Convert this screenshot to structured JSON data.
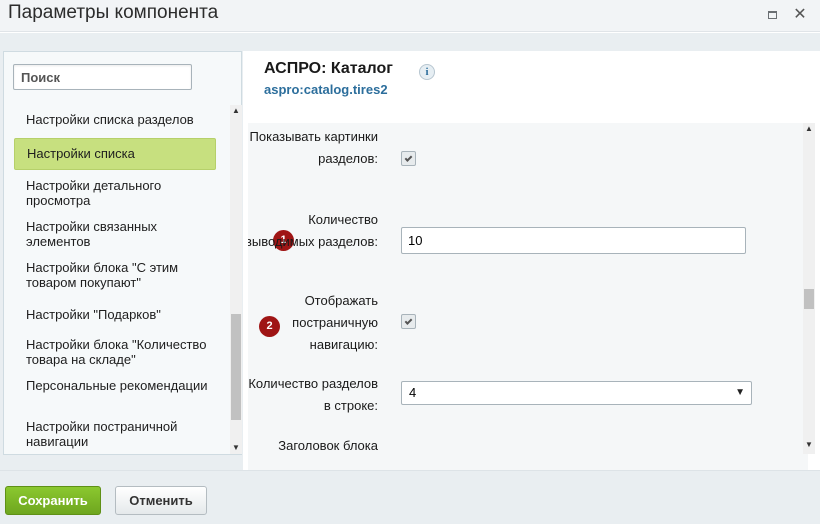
{
  "dialog": {
    "title": "Параметры компонента",
    "maximize_icon": "maximize-icon",
    "close_icon": "close-icon",
    "close_glyph": "✕"
  },
  "sidebar": {
    "search_placeholder": "Поиск",
    "items": [
      {
        "label": "Настройки списка разделов",
        "active": false
      },
      {
        "label": "Настройки списка",
        "active": true
      },
      {
        "label": "Настройки детального просмотра",
        "active": false
      },
      {
        "label": "Настройки связанных элементов",
        "active": false
      },
      {
        "label": "Настройки блока \"С этим товаром покупают\"",
        "active": false
      },
      {
        "label": "Настройки \"Подарков\"",
        "active": false
      },
      {
        "label": "Настройки блока \"Количество товара на складе\"",
        "active": false
      },
      {
        "label": "Персональные рекомендации",
        "active": false
      },
      {
        "label": "Настройки постраничной навигации",
        "active": false
      }
    ],
    "active_color": "#c7e07f"
  },
  "component": {
    "title": "АСПРО: Каталог",
    "info_icon": "info-icon",
    "info_glyph": "i",
    "code": "aspro:catalog.tires2",
    "code_color": "#2c6e9c"
  },
  "settings": {
    "show_section_pictures": {
      "label": "Показывать картинки разделов:",
      "checked": true
    },
    "section_count": {
      "label": "Количество выводимых разделов:",
      "value": "10",
      "badge": "1"
    },
    "show_pagination": {
      "label": "Отображать постраничную навигацию:",
      "checked": true,
      "badge": "2"
    },
    "sections_per_row": {
      "label": "Количество разделов в строке:",
      "value": "4"
    },
    "block_title": {
      "label": "Заголовок блока"
    }
  },
  "footer": {
    "save_label": "Сохранить",
    "cancel_label": "Отменить",
    "save_color": "#7ab528"
  },
  "badge_color": "#9f1515"
}
